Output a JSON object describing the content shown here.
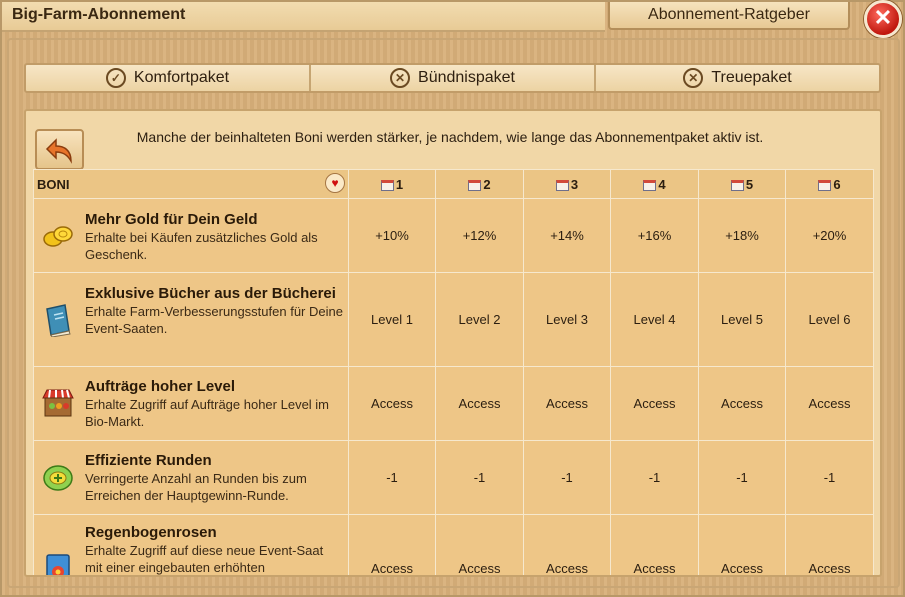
{
  "window": {
    "title": "Big-Farm-Abonnement",
    "advisor_button": "Abonnement-Ratgeber",
    "close_symbol": "✕"
  },
  "tabs": [
    {
      "label": "Komfortpaket",
      "icon": "check-circle-icon",
      "icon_glyph": "✓"
    },
    {
      "label": "Bündnispaket",
      "icon": "x-circle-icon",
      "icon_glyph": "✕"
    },
    {
      "label": "Treuepaket",
      "icon": "x-circle-icon",
      "icon_glyph": "✕"
    }
  ],
  "notice": "Manche der beinhalteten Boni werden stärker, je nachdem, wie lange das Abonnementpaket aktiv ist.",
  "table": {
    "boni_header": "BONI",
    "periods": [
      "1",
      "2",
      "3",
      "4",
      "5",
      "6"
    ],
    "rows": [
      {
        "title": "Mehr Gold für Dein Geld",
        "desc": "Erhalte bei Käufen zusätzliches Gold als Geschenk.",
        "icon": "gold-coins-icon",
        "values": [
          "+10%",
          "+12%",
          "+14%",
          "+16%",
          "+18%",
          "+20%"
        ]
      },
      {
        "title": "Exklusive Bücher aus der Bücherei",
        "desc": "Erhalte Farm-Verbesserungsstufen für Deine Event-Saaten.",
        "icon": "book-icon",
        "values": [
          "Level 1",
          "Level 2",
          "Level 3",
          "Level 4",
          "Level 5",
          "Level 6"
        ]
      },
      {
        "title": "Aufträge hoher Level",
        "desc": "Erhalte Zugriff auf Aufträge hoher Level im Bio-Markt.",
        "icon": "market-stall-icon",
        "values": [
          "Access",
          "Access",
          "Access",
          "Access",
          "Access",
          "Access"
        ]
      },
      {
        "title": "Effiziente Runden",
        "desc": "Verringerte Anzahl an Runden bis zum Erreichen der Hauptgewinn-Runde.",
        "icon": "green-badge-icon",
        "values": [
          "-1",
          "-1",
          "-1",
          "-1",
          "-1",
          "-1"
        ]
      },
      {
        "title": "Regenbogenrosen",
        "desc": "Erhalte Zugriff auf diese neue Event-Saat mit einer eingebauten erhöhten",
        "icon": "seed-packet-icon",
        "values": [
          "Access",
          "Access",
          "Access",
          "Access",
          "Access",
          "Access"
        ]
      }
    ]
  }
}
